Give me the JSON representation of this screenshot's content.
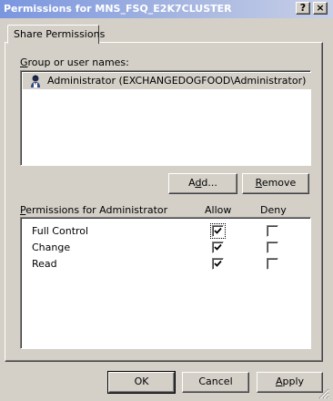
{
  "window": {
    "title": "Permissions for MNS_FSQ_E2K7CLUSTER",
    "help_glyph": "?",
    "close_glyph": "×"
  },
  "tabs": [
    {
      "label": "Share Permissions",
      "active": true
    }
  ],
  "group_section": {
    "label_prefix": "",
    "label_accel": "G",
    "label_rest": "roup or user names:",
    "users": [
      {
        "name": "Administrator (EXCHANGEDOGFOOD\\Administrator)",
        "icon": "user-icon",
        "selected": true
      }
    ]
  },
  "buttons": {
    "add_pre": "A",
    "add_accel": "d",
    "add_post": "d...",
    "remove_pre": "",
    "remove_accel": "R",
    "remove_post": "emove",
    "ok": "OK",
    "cancel": "Cancel",
    "apply_pre": "",
    "apply_accel": "A",
    "apply_post": "pply"
  },
  "permissions": {
    "label_accel": "P",
    "label_rest": "ermissions for Administrator",
    "col_allow": "Allow",
    "col_deny": "Deny",
    "rows": [
      {
        "name": "Full Control",
        "allow": true,
        "deny": false
      },
      {
        "name": "Change",
        "allow": true,
        "deny": false
      },
      {
        "name": "Read",
        "allow": true,
        "deny": false
      }
    ]
  },
  "colors": {
    "titlebar_start": "#7a96df",
    "titlebar_end": "#c8d0e8",
    "face": "#d4d0c8",
    "selected_row": "#d4d0c8"
  }
}
